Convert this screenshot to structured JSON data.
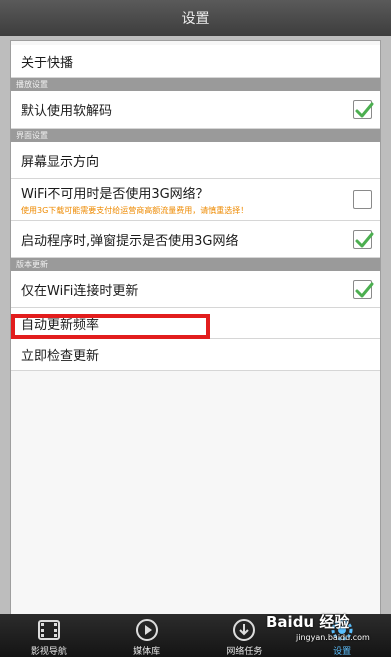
{
  "header": {
    "title": "设置"
  },
  "settings": {
    "about": "关于快播",
    "sections": {
      "playback": "播放设置",
      "other": "界面设置",
      "update": "版本更新"
    },
    "rows": {
      "soft_decode": {
        "label": "默认使用软解码",
        "checked": true
      },
      "orientation": {
        "label": "屏幕显示方向"
      },
      "use_3g": {
        "label": "WiFi不可用时是否使用3G网络？",
        "sub": "使用3G下载可能需要支付给运营商高额流量费用，请慎重选择！",
        "checked": false
      },
      "startup_3g": {
        "label": "启动程序时,弹窗提示是否使用3G网络",
        "checked": true
      },
      "wifi_update": {
        "label": "仅在WiFi连接时更新",
        "checked": true
      },
      "auto_update_freq": {
        "label": "自动更新频率"
      },
      "check_update": {
        "label": "立即检查更新"
      }
    }
  },
  "bottom_nav": {
    "items": [
      {
        "label": "影视导航",
        "icon": "film-icon"
      },
      {
        "label": "媒体库",
        "icon": "play-icon"
      },
      {
        "label": "网络任务",
        "icon": "download-icon"
      },
      {
        "label": "设置",
        "icon": "settings-icon",
        "active": true
      }
    ]
  },
  "watermark": {
    "brand": "Baidu 经验",
    "url": "jingyan.baidu.com"
  },
  "colors": {
    "highlight": "#e21d1d",
    "checkmark": "#4caf50",
    "warning_text": "#ee8a00"
  }
}
